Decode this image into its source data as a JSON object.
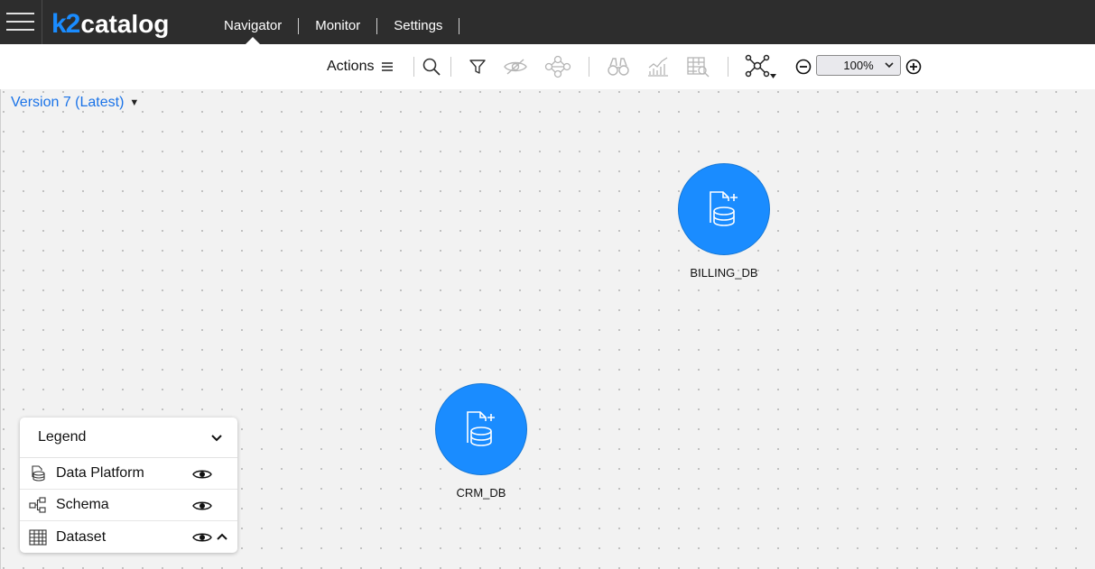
{
  "app": {
    "logo_k2": "k2",
    "logo_name": "catalog"
  },
  "nav": {
    "items": [
      "Navigator",
      "Monitor",
      "Settings"
    ],
    "active": "Navigator"
  },
  "toolbar": {
    "actions_label": "Actions",
    "icons": [
      "search-icon",
      "filter-icon",
      "hide-icon",
      "graph-icon",
      "binoculars-icon",
      "chart-icon",
      "table-search-icon",
      "network-icon",
      "zoom-out-icon",
      "zoom-in-icon"
    ],
    "zoom_value": "100%"
  },
  "version": {
    "label": "Version 7 (Latest)"
  },
  "nodes": [
    {
      "label": "BILLING_DB",
      "icon": "database-add-icon"
    },
    {
      "label": "CRM_DB",
      "icon": "database-add-icon"
    }
  ],
  "legend": {
    "title": "Legend",
    "items": [
      {
        "label": "Data Platform",
        "icon": "data-platform-icon"
      },
      {
        "label": "Schema",
        "icon": "schema-icon"
      },
      {
        "label": "Dataset",
        "icon": "dataset-icon"
      }
    ]
  },
  "colors": {
    "accent": "#1a8cff",
    "topbar": "#2d2d2d",
    "link": "#1a73e8"
  }
}
